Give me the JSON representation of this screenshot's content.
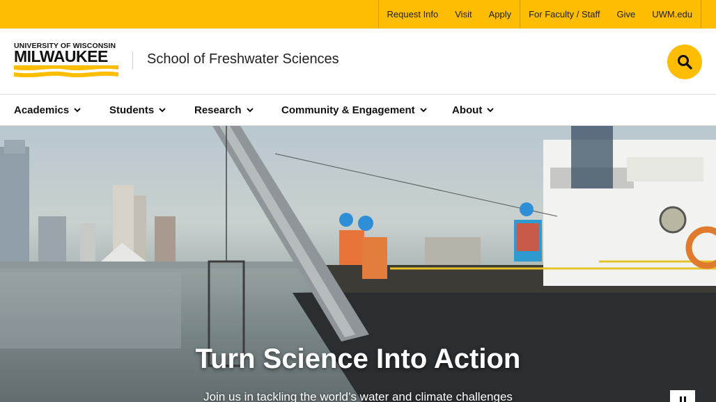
{
  "utility_nav": {
    "group_one": [
      "Request Info",
      "Visit",
      "Apply"
    ],
    "group_two": [
      "For Faculty / Staff",
      "Give",
      "UWM.edu"
    ]
  },
  "header": {
    "logo_top": "UNIVERSITY OF WISCONSIN",
    "logo_main": "MILWAUKEE",
    "site_title": "School of Freshwater Sciences"
  },
  "main_nav": {
    "items": [
      "Academics",
      "Students",
      "Research",
      "Community & Engagement",
      "About"
    ]
  },
  "hero": {
    "title": "Turn Science Into Action",
    "subtitle": "Join us in tackling the world’s water and climate challenges"
  },
  "colors": {
    "brand_gold": "#ffbd00",
    "text_dark": "#111111"
  },
  "icons": {
    "search": "search-icon",
    "chevron": "chevron-down-icon",
    "pause": "pause-icon"
  }
}
